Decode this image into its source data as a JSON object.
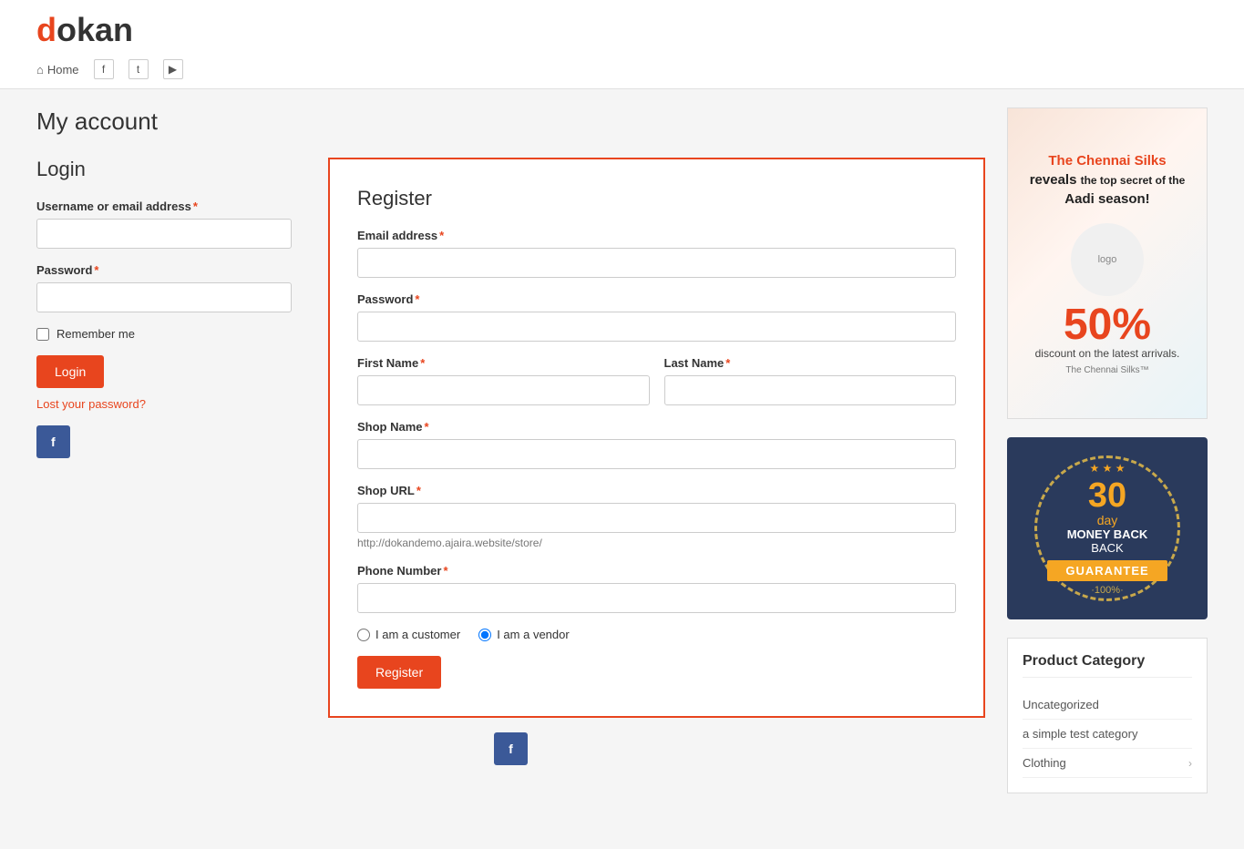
{
  "header": {
    "logo_text": "dokan",
    "logo_d": "d",
    "logo_rest": "okan",
    "nav_home": "Home",
    "nav_facebook": "f",
    "nav_twitter": "t",
    "nav_youtube": "▶"
  },
  "page": {
    "title": "My account"
  },
  "login": {
    "title": "Login",
    "username_label": "Username or email address",
    "username_required": "*",
    "username_placeholder": "",
    "password_label": "Password",
    "password_required": "*",
    "password_placeholder": "",
    "remember_label": "Remember me",
    "login_button": "Login",
    "lost_password": "Lost your password?",
    "facebook_label": "f"
  },
  "register": {
    "title": "Register",
    "email_label": "Email address",
    "email_required": "*",
    "email_placeholder": "",
    "password_label": "Password",
    "password_required": "*",
    "password_placeholder": "",
    "first_name_label": "First Name",
    "first_name_required": "*",
    "first_name_placeholder": "",
    "last_name_label": "Last Name",
    "last_name_required": "*",
    "last_name_placeholder": "",
    "shop_name_label": "Shop Name",
    "shop_name_required": "*",
    "shop_name_placeholder": "",
    "shop_url_label": "Shop URL",
    "shop_url_required": "*",
    "shop_url_placeholder": "",
    "shop_url_hint": "http://dokandemo.ajaira.website/store/",
    "phone_label": "Phone Number",
    "phone_required": "*",
    "phone_placeholder": "",
    "radio_customer": "I am a customer",
    "radio_vendor": "I am a vendor",
    "register_button": "Register",
    "facebook_label": "f"
  },
  "sidebar": {
    "ad_title_line1": "The Chennai Silks",
    "ad_title_line2": "reveals",
    "ad_title_line3": "the top secret of the",
    "ad_title_line4": "Aadi season!",
    "ad_discount": "50%",
    "ad_discount_text": "discount on the latest arrivals.",
    "badge_days": "30",
    "badge_day": "day",
    "badge_money": "MONEY BACK",
    "badge_guarantee": "GUARANTEE",
    "badge_percent": "·100%·",
    "product_category_title": "Product Category",
    "categories": [
      {
        "name": "Uncategorized",
        "has_arrow": false
      },
      {
        "name": "a simple test category",
        "has_arrow": false
      },
      {
        "name": "Clothing",
        "has_arrow": true
      }
    ]
  }
}
